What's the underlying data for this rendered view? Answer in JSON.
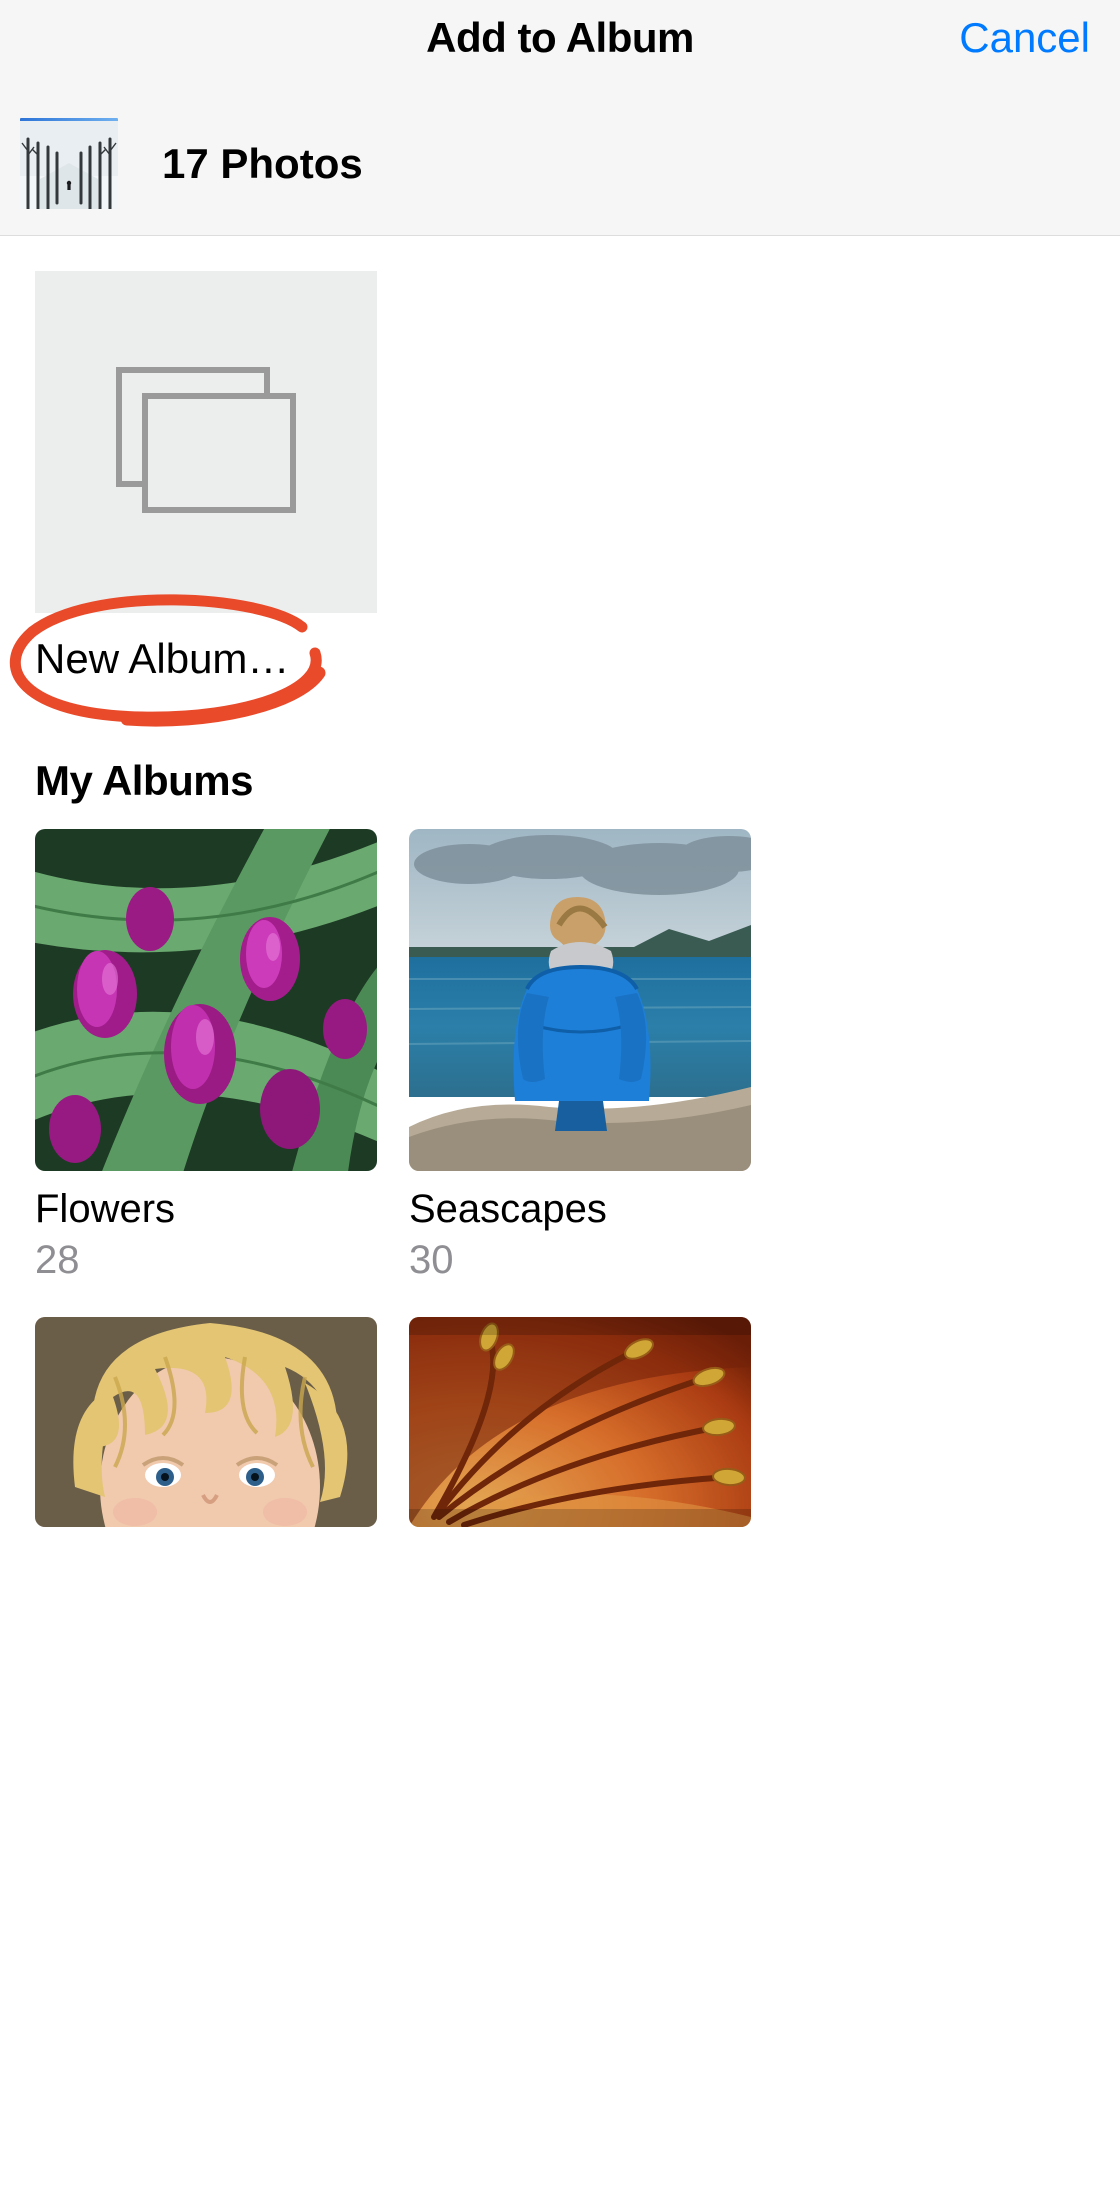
{
  "header": {
    "title": "Add to Album",
    "cancel_label": "Cancel"
  },
  "selection": {
    "count_label": "17 Photos"
  },
  "new_album": {
    "label": "New Album…"
  },
  "sections": {
    "my_albums": {
      "title": "My Albums",
      "albums": [
        {
          "name": "Flowers",
          "count": "28"
        },
        {
          "name": "Seascapes",
          "count": "30"
        },
        {
          "name": "",
          "count": ""
        },
        {
          "name": "",
          "count": ""
        }
      ]
    }
  },
  "annotation": {
    "target": "new-album-label",
    "style": "hand-drawn-circle",
    "color": "#e84a2a"
  }
}
